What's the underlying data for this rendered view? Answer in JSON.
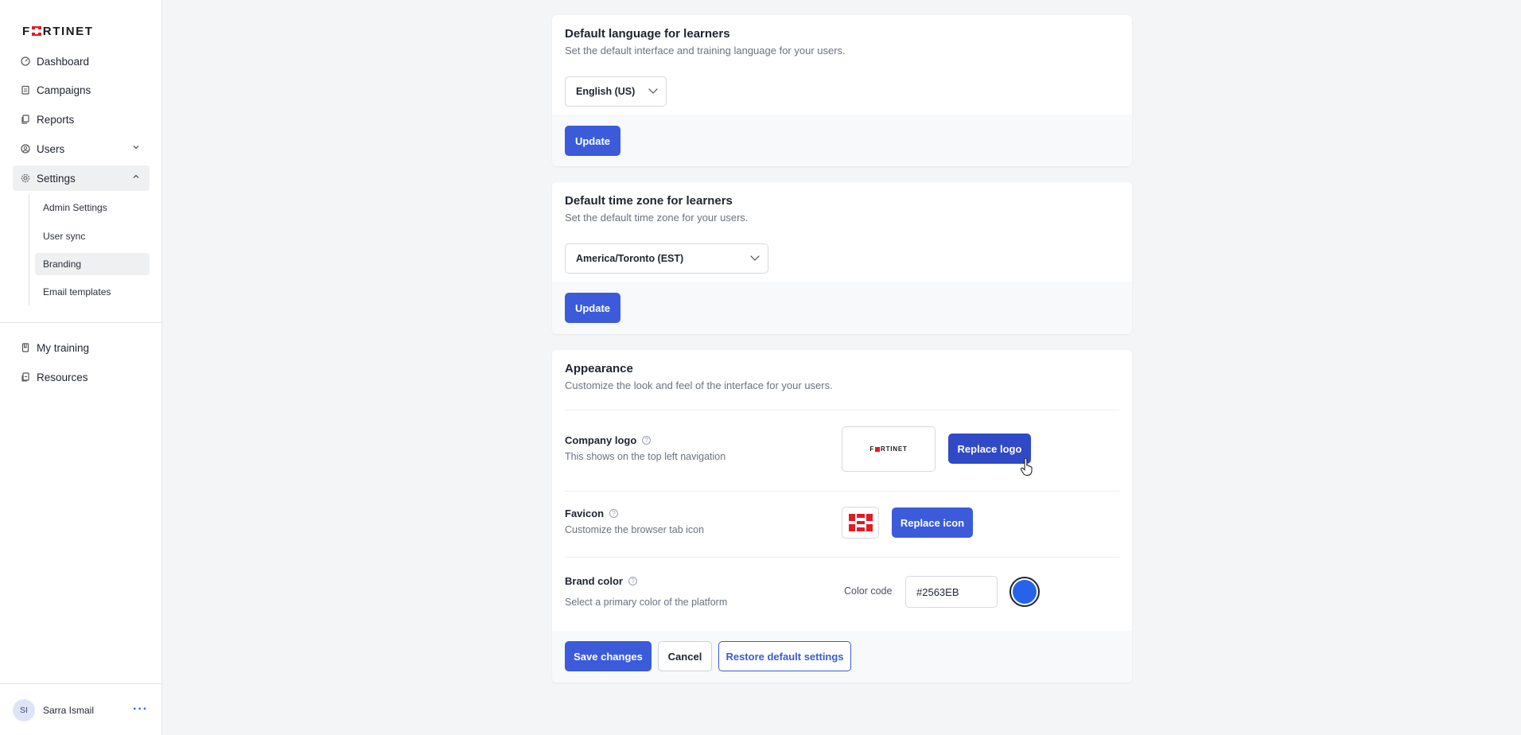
{
  "brand": {
    "logo_text_pre": "F",
    "logo_text_post": "RTINET"
  },
  "nav": {
    "items": [
      {
        "label": "Dashboard",
        "icon": "gauge-icon"
      },
      {
        "label": "Campaigns",
        "icon": "clipboard-icon"
      },
      {
        "label": "Reports",
        "icon": "copy-icon"
      },
      {
        "label": "Users",
        "icon": "user-circle-icon"
      },
      {
        "label": "Settings",
        "icon": "gear-icon"
      }
    ],
    "settings_sub": [
      {
        "label": "Admin Settings"
      },
      {
        "label": "User sync"
      },
      {
        "label": "Branding"
      },
      {
        "label": "Email templates"
      }
    ],
    "bottom": [
      {
        "label": "My training",
        "icon": "book-icon"
      },
      {
        "label": "Resources",
        "icon": "resource-icon"
      }
    ]
  },
  "user": {
    "initials": "SI",
    "name": "Sarra Ismail",
    "more": "···"
  },
  "language": {
    "title": "Default language for learners",
    "description": "Set the default interface and training language for your users.",
    "selected": "English (US)",
    "update_label": "Update"
  },
  "timezone": {
    "title": "Default time zone for learners",
    "description": "Set the default time zone for your users.",
    "selected": "America/Toronto (EST)",
    "update_label": "Update"
  },
  "appearance": {
    "title": "Appearance",
    "description": "Customize the look and feel of the interface for your users.",
    "logo": {
      "label": "Company logo",
      "description": "This shows on the top left navigation",
      "button": "Replace logo",
      "preview_pre": "F",
      "preview_post": "RTINET"
    },
    "favicon": {
      "label": "Favicon",
      "description": "Customize the browser tab icon",
      "button": "Replace icon"
    },
    "brand_color": {
      "label": "Brand color",
      "description": "Select a primary color of the platform",
      "code_label": "Color code",
      "value": "#2563EB",
      "swatch": "#2563EB"
    },
    "save_label": "Save changes",
    "cancel_label": "Cancel",
    "restore_label": "Restore default settings"
  },
  "colors": {
    "accent": "#3B5BDB",
    "brand_red": "#E41B23"
  }
}
